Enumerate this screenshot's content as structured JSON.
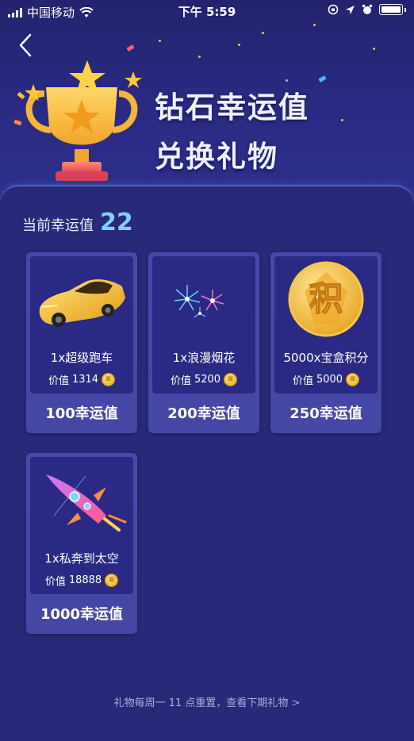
{
  "status_bar": {
    "carrier": "中国移动",
    "time": "下午 5:59"
  },
  "header": {
    "title_line1": "钻石幸运值",
    "title_line2": "兑换礼物"
  },
  "lucky": {
    "label": "当前幸运值",
    "value": "22"
  },
  "gifts": [
    {
      "name": "1x超级跑车",
      "price_label": "价值",
      "price": "1314",
      "cost": "100幸运值",
      "icon": "sports-car-icon"
    },
    {
      "name": "1x浪漫烟花",
      "price_label": "价值",
      "price": "5200",
      "cost": "200幸运值",
      "icon": "fireworks-icon"
    },
    {
      "name": "5000x宝盒积分",
      "price_label": "价值",
      "price": "5000",
      "cost": "250幸运值",
      "icon": "points-coin-icon",
      "icon_text": "积"
    },
    {
      "name": "1x私奔到太空",
      "price_label": "价值",
      "price": "18888",
      "cost": "1000幸运值",
      "icon": "rocket-icon"
    }
  ],
  "footer": {
    "note": "礼物每周一 11 点重置，查看下期礼物 >"
  },
  "colors": {
    "background": "#2a2a7a",
    "card": "#4646a4",
    "lucky_value": "#7fd0ff"
  }
}
